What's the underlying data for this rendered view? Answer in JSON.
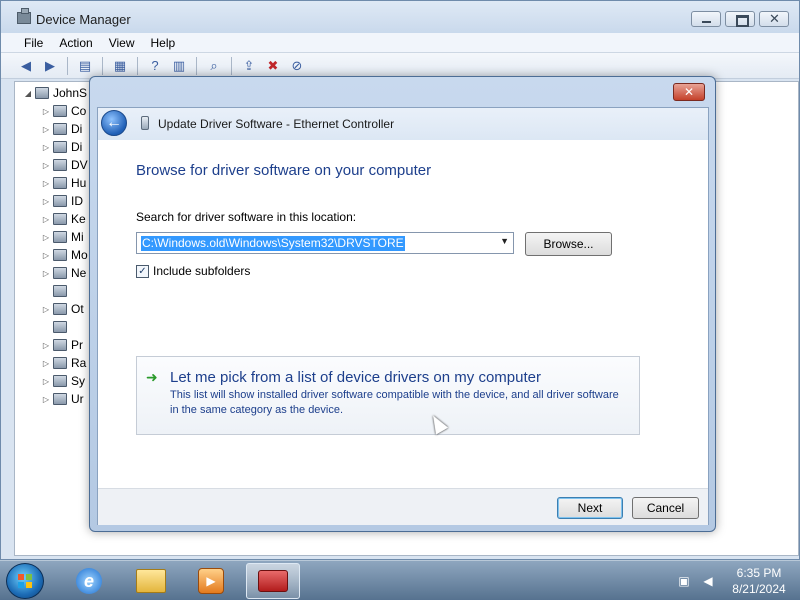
{
  "device_manager": {
    "title": "Device Manager",
    "menu": [
      "File",
      "Action",
      "View",
      "Help"
    ],
    "toolbar_icons": [
      "back-arrow-icon",
      "forward-arrow-icon",
      "tree-icon",
      "properties-icon",
      "help-icon",
      "view-icon",
      "scan-hardware-icon",
      "update-driver-icon",
      "uninstall-icon",
      "disable-icon"
    ],
    "tree": {
      "root": "JohnS",
      "items": [
        "Co",
        "Di",
        "Di",
        "DV",
        "Hu",
        "ID",
        "Ke",
        "Mi",
        "Mo",
        "Ne",
        "",
        "Ot",
        "",
        "Pr",
        "Ra",
        "Sy",
        "Ur"
      ]
    }
  },
  "dialog": {
    "title": "Update Driver Software - Ethernet Controller",
    "heading": "Browse for driver software on your computer",
    "search_label": "Search for driver software in this location:",
    "path_value": "C:\\Windows.old\\Windows\\System32\\DRVSTORE",
    "browse_label": "Browse...",
    "include_subfolders_label": "Include subfolders",
    "include_subfolders_checked": true,
    "pick_title": "Let me pick from a list of device drivers on my computer",
    "pick_desc": "This list will show installed driver software compatible with the device, and all driver software in the same category as the device.",
    "next_label": "Next",
    "cancel_label": "Cancel",
    "close_glyph": "✕"
  },
  "taskbar": {
    "apps": [
      "internet-explorer",
      "windows-explorer",
      "media-player",
      "device-manager"
    ],
    "time": "6:35 PM",
    "date": "8/21/2024"
  }
}
